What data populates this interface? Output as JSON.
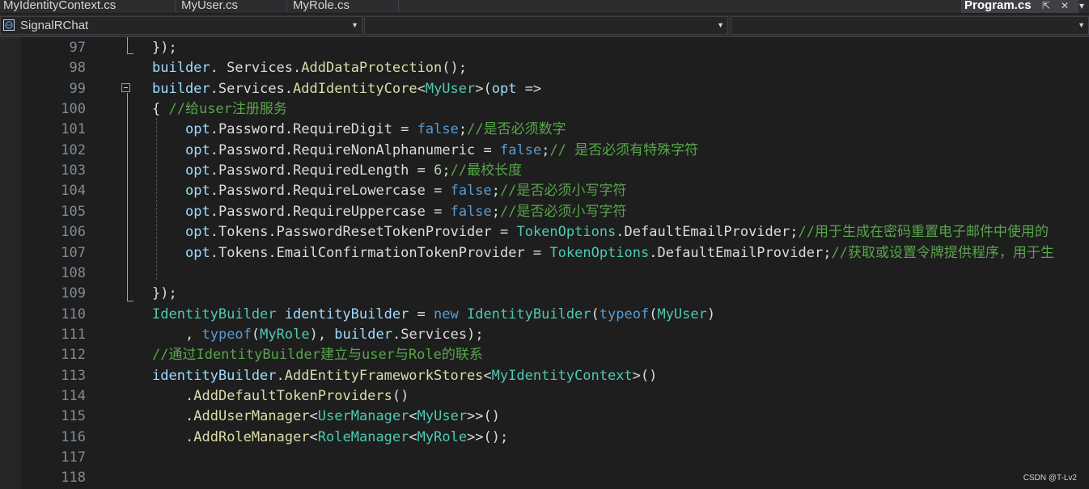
{
  "tabs": [
    {
      "label": "MyIdentityContext.cs",
      "active": false
    },
    {
      "label": "MyUser.cs",
      "active": false
    },
    {
      "label": "MyRole.cs",
      "active": false
    },
    {
      "label": "Program.cs",
      "active": true
    }
  ],
  "navbar": {
    "project": "SignalRChat",
    "member": "",
    "symbol": ""
  },
  "code_lines": [
    {
      "n": "97",
      "segs": [
        [
          "",
          "});"
        ]
      ]
    },
    {
      "n": "98",
      "segs": [
        [
          "param",
          "builder"
        ],
        [
          "",
          ". "
        ],
        [
          "prop",
          "Services"
        ],
        [
          "",
          "."
        ],
        [
          "method",
          "AddDataProtection"
        ],
        [
          "",
          "();"
        ]
      ]
    },
    {
      "n": "99",
      "segs": [
        [
          "param",
          "builder"
        ],
        [
          "",
          "."
        ],
        [
          "prop",
          "Services"
        ],
        [
          "",
          "."
        ],
        [
          "method",
          "AddIdentityCore"
        ],
        [
          "",
          "<"
        ],
        [
          "type",
          "MyUser"
        ],
        [
          "",
          ">("
        ],
        [
          "param",
          "opt"
        ],
        [
          "",
          " =>"
        ]
      ]
    },
    {
      "n": "100",
      "segs": [
        [
          "",
          "{ "
        ],
        [
          "comment",
          "//给user注册服务"
        ]
      ]
    },
    {
      "n": "101",
      "indent": true,
      "segs": [
        [
          "param",
          "opt"
        ],
        [
          "",
          "."
        ],
        [
          "prop",
          "Password"
        ],
        [
          "",
          "."
        ],
        [
          "prop",
          "RequireDigit"
        ],
        [
          "",
          " = "
        ],
        [
          "kw",
          "false"
        ],
        [
          "",
          ";"
        ],
        [
          "comment",
          "//是否必须数字"
        ]
      ]
    },
    {
      "n": "102",
      "indent": true,
      "segs": [
        [
          "param",
          "opt"
        ],
        [
          "",
          "."
        ],
        [
          "prop",
          "Password"
        ],
        [
          "",
          "."
        ],
        [
          "prop",
          "RequireNonAlphanumeric"
        ],
        [
          "",
          " = "
        ],
        [
          "kw",
          "false"
        ],
        [
          "",
          ";"
        ],
        [
          "comment",
          "// 是否必须有特殊字符"
        ]
      ]
    },
    {
      "n": "103",
      "indent": true,
      "segs": [
        [
          "param",
          "opt"
        ],
        [
          "",
          "."
        ],
        [
          "prop",
          "Password"
        ],
        [
          "",
          "."
        ],
        [
          "prop",
          "RequiredLength"
        ],
        [
          "",
          " = "
        ],
        [
          "num",
          "6"
        ],
        [
          "",
          ";"
        ],
        [
          "comment",
          "//最校长度"
        ]
      ]
    },
    {
      "n": "104",
      "indent": true,
      "segs": [
        [
          "param",
          "opt"
        ],
        [
          "",
          "."
        ],
        [
          "prop",
          "Password"
        ],
        [
          "",
          "."
        ],
        [
          "prop",
          "RequireLowercase"
        ],
        [
          "",
          " = "
        ],
        [
          "kw",
          "false"
        ],
        [
          "",
          ";"
        ],
        [
          "comment",
          "//是否必须小写字符"
        ]
      ]
    },
    {
      "n": "105",
      "indent": true,
      "segs": [
        [
          "param",
          "opt"
        ],
        [
          "",
          "."
        ],
        [
          "prop",
          "Password"
        ],
        [
          "",
          "."
        ],
        [
          "prop",
          "RequireUppercase"
        ],
        [
          "",
          " = "
        ],
        [
          "kw",
          "false"
        ],
        [
          "",
          ";"
        ],
        [
          "comment",
          "//是否必须小写字符"
        ]
      ]
    },
    {
      "n": "106",
      "indent": true,
      "segs": [
        [
          "param",
          "opt"
        ],
        [
          "",
          "."
        ],
        [
          "prop",
          "Tokens"
        ],
        [
          "",
          "."
        ],
        [
          "prop",
          "PasswordResetTokenProvider"
        ],
        [
          "",
          " = "
        ],
        [
          "type",
          "TokenOptions"
        ],
        [
          "",
          "."
        ],
        [
          "prop",
          "DefaultEmailProvider"
        ],
        [
          "",
          ";"
        ],
        [
          "comment",
          "//用于生成在密码重置电子邮件中使用的"
        ]
      ]
    },
    {
      "n": "107",
      "indent": true,
      "segs": [
        [
          "param",
          "opt"
        ],
        [
          "",
          "."
        ],
        [
          "prop",
          "Tokens"
        ],
        [
          "",
          "."
        ],
        [
          "prop",
          "EmailConfirmationTokenProvider"
        ],
        [
          "",
          " = "
        ],
        [
          "type",
          "TokenOptions"
        ],
        [
          "",
          "."
        ],
        [
          "prop",
          "DefaultEmailProvider"
        ],
        [
          "",
          ";"
        ],
        [
          "comment",
          "//获取或设置令牌提供程序，用于生"
        ]
      ]
    },
    {
      "n": "108",
      "segs": []
    },
    {
      "n": "109",
      "segs": [
        [
          "",
          "});"
        ]
      ]
    },
    {
      "n": "110",
      "segs": [
        [
          "type",
          "IdentityBuilder"
        ],
        [
          "",
          " "
        ],
        [
          "param",
          "identityBuilder"
        ],
        [
          "",
          " = "
        ],
        [
          "kw",
          "new"
        ],
        [
          "",
          " "
        ],
        [
          "type",
          "IdentityBuilder"
        ],
        [
          "",
          "("
        ],
        [
          "kw",
          "typeof"
        ],
        [
          "",
          "("
        ],
        [
          "type",
          "MyUser"
        ],
        [
          "",
          ")"
        ]
      ]
    },
    {
      "n": "111",
      "indent": true,
      "segs": [
        [
          "",
          ", "
        ],
        [
          "kw",
          "typeof"
        ],
        [
          "",
          "("
        ],
        [
          "type",
          "MyRole"
        ],
        [
          "",
          "), "
        ],
        [
          "param",
          "builder"
        ],
        [
          "",
          "."
        ],
        [
          "prop",
          "Services"
        ],
        [
          "",
          ");"
        ]
      ]
    },
    {
      "n": "112",
      "segs": [
        [
          "comment",
          "//通过IdentityBuilder建立与user与Role的联系"
        ]
      ]
    },
    {
      "n": "113",
      "segs": [
        [
          "param",
          "identityBuilder"
        ],
        [
          "",
          "."
        ],
        [
          "method",
          "AddEntityFrameworkStores"
        ],
        [
          "",
          "<"
        ],
        [
          "type",
          "MyIdentityContext"
        ],
        [
          "",
          ">()"
        ]
      ]
    },
    {
      "n": "114",
      "indent": true,
      "segs": [
        [
          "",
          "."
        ],
        [
          "method",
          "AddDefaultTokenProviders"
        ],
        [
          "",
          "()"
        ]
      ]
    },
    {
      "n": "115",
      "indent": true,
      "segs": [
        [
          "",
          "."
        ],
        [
          "method",
          "AddUserManager"
        ],
        [
          "",
          "<"
        ],
        [
          "type",
          "UserManager"
        ],
        [
          "",
          "<"
        ],
        [
          "type",
          "MyUser"
        ],
        [
          "",
          ">>()"
        ]
      ]
    },
    {
      "n": "116",
      "indent": true,
      "segs": [
        [
          "",
          "."
        ],
        [
          "method",
          "AddRoleManager"
        ],
        [
          "",
          "<"
        ],
        [
          "type",
          "RoleManager"
        ],
        [
          "",
          "<"
        ],
        [
          "type",
          "MyRole"
        ],
        [
          "",
          ">>();"
        ]
      ]
    },
    {
      "n": "117",
      "segs": []
    },
    {
      "n": "118",
      "segs": []
    }
  ],
  "watermark": "CSDN @T-Lv2",
  "colors": {
    "background": "#1e1e1e",
    "keyword": "#569cd6",
    "type": "#4ec9b0",
    "method": "#dcdcaa",
    "variable": "#9cdcfe",
    "number": "#b5cea8",
    "comment": "#57a64a"
  },
  "icons": [
    "pin-icon",
    "close-icon",
    "tab-list-icon",
    "project-icon",
    "dropdown-arrow-icon",
    "collapse-icon"
  ]
}
